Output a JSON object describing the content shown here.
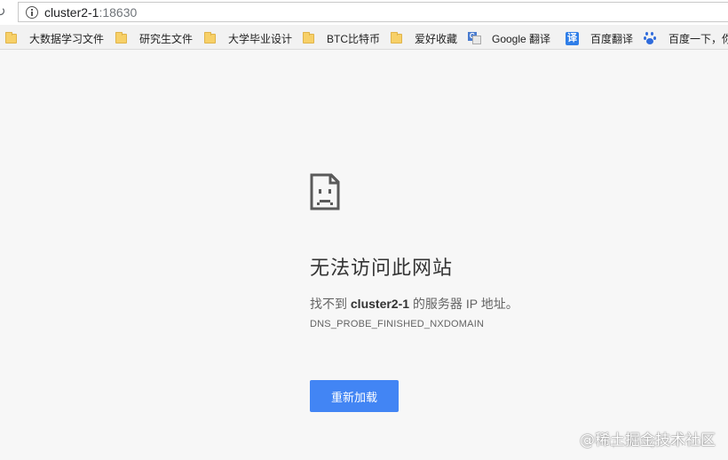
{
  "address_bar": {
    "url_host": "cluster2-1",
    "url_port": ":18630"
  },
  "bookmarks": [
    {
      "label": "大数据学习文件",
      "icon": "folder-icon"
    },
    {
      "label": "研究生文件",
      "icon": "folder-icon"
    },
    {
      "label": "大学毕业设计",
      "icon": "folder-icon"
    },
    {
      "label": "BTC比特币",
      "icon": "folder-icon"
    },
    {
      "label": "爱好收藏",
      "icon": "folder-icon"
    },
    {
      "label": "Google 翻译",
      "icon": "google-translate-icon"
    },
    {
      "label": "百度翻译",
      "icon": "baidu-translate-icon",
      "glyph": "译"
    },
    {
      "label": "百度一下，你",
      "icon": "baidu-paw-icon"
    }
  ],
  "error": {
    "icon": "sad-page-icon",
    "headline": "无法访问此网站",
    "desc_prefix": "找不到 ",
    "desc_host": "cluster2-1",
    "desc_suffix": " 的服务器 IP 地址。",
    "code": "DNS_PROBE_FINISHED_NXDOMAIN",
    "reload_label": "重新加载"
  },
  "watermark": {
    "text": "@稀土掘金技术社区",
    "url": "https://blog.csdn.net/..."
  },
  "colors": {
    "button": "#4285f4",
    "page_bg": "#f7f7f7"
  }
}
